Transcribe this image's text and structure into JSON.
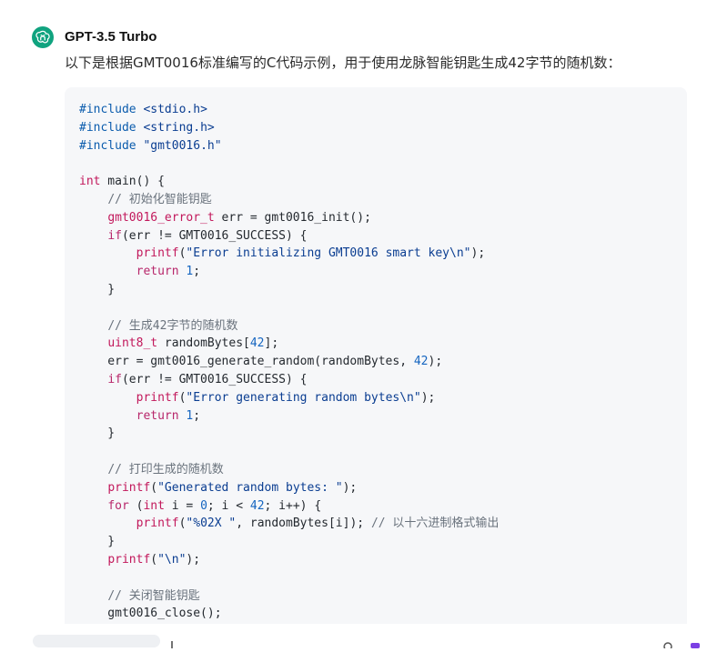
{
  "header": {
    "model_name": "GPT-3.5 Turbo",
    "avatar_icon": "openai-logo-icon",
    "avatar_color": "#10a37f"
  },
  "message": {
    "intro": "以下是根据GMT0016标准编写的C代码示例，用于使用龙脉智能钥匙生成42字节的随机数："
  },
  "code": {
    "language": "c",
    "lines": [
      "#include <stdio.h>",
      "#include <string.h>",
      "#include \"gmt0016.h\"",
      "",
      "int main() {",
      "    // 初始化智能钥匙",
      "    gmt0016_error_t err = gmt0016_init();",
      "    if(err != GMT0016_SUCCESS) {",
      "        printf(\"Error initializing GMT0016 smart key\\n\");",
      "        return 1;",
      "    }",
      "",
      "    // 生成42字节的随机数",
      "    uint8_t randomBytes[42];",
      "    err = gmt0016_generate_random(randomBytes, 42);",
      "    if(err != GMT0016_SUCCESS) {",
      "        printf(\"Error generating random bytes\\n\");",
      "        return 1;",
      "    }",
      "",
      "    // 打印生成的随机数",
      "    printf(\"Generated random bytes: \");",
      "    for (int i = 0; i < 42; i++) {",
      "        printf(\"%02X \", randomBytes[i]); // 以十六进制格式输出",
      "    }",
      "    printf(\"\\n\");",
      "",
      "    // 关闭智能钥匙",
      "    gmt0016_close();"
    ]
  }
}
